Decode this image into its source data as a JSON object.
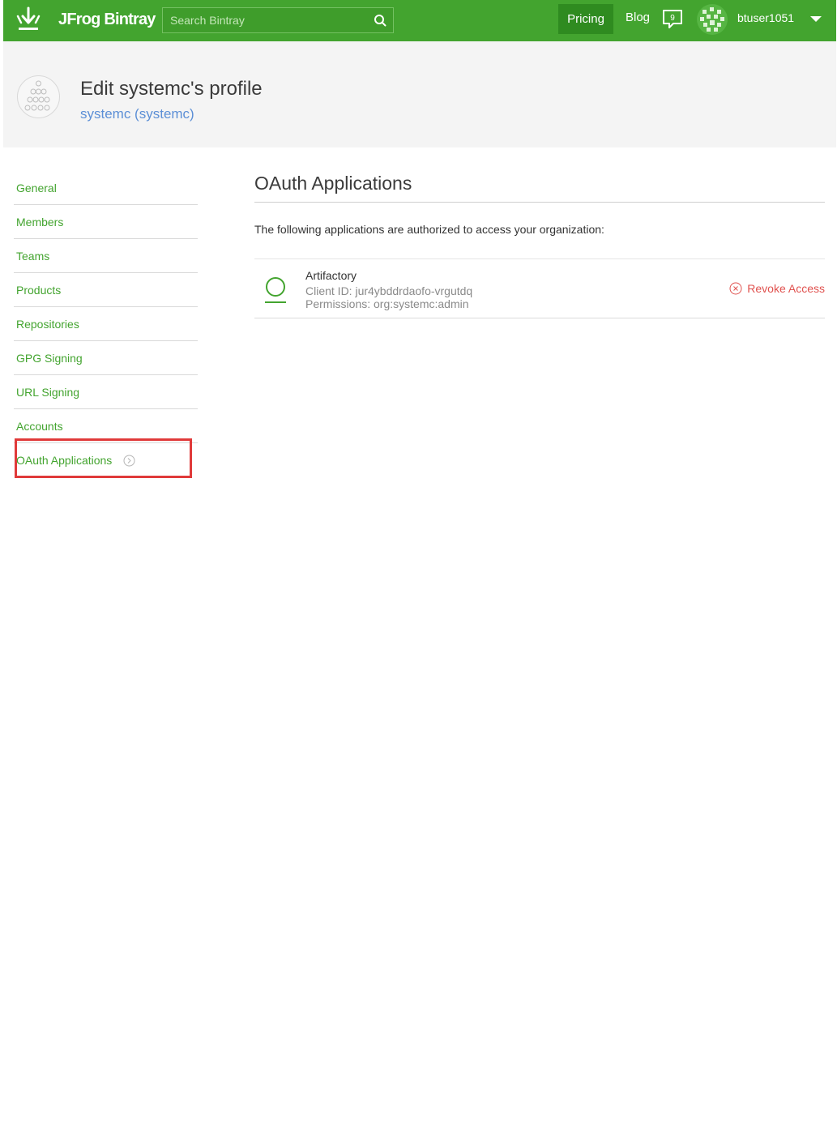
{
  "nav": {
    "brand": "JFrog Bintray",
    "search_placeholder": "Search Bintray",
    "pricing": "Pricing",
    "blog": "Blog",
    "chat_badge": "9",
    "username": "btuser1051"
  },
  "header": {
    "title": "Edit systemc's profile",
    "subtitle": "systemc (systemc)"
  },
  "sidebar": {
    "items": [
      {
        "label": "General"
      },
      {
        "label": "Members"
      },
      {
        "label": "Teams"
      },
      {
        "label": "Products"
      },
      {
        "label": "Repositories"
      },
      {
        "label": "GPG Signing"
      },
      {
        "label": "URL Signing"
      },
      {
        "label": "Accounts"
      },
      {
        "label": "OAuth Applications"
      }
    ],
    "active": "OAuth Applications"
  },
  "main": {
    "title": "OAuth Applications",
    "intro": "The following applications are authorized to access your organization:",
    "apps": [
      {
        "name": "Artifactory",
        "client_id": "Client ID: jur4ybddrdaofo-vrgutdq",
        "permissions": "Permissions: org:systemc:admin",
        "action": "Revoke Access"
      }
    ]
  },
  "colors": {
    "brand_green": "#43a42f",
    "pricing_bg": "#2f8b20",
    "revoke_red": "#e0524f",
    "highlight_red": "#e03a3a",
    "subtitle_blue": "#5c8fd6"
  }
}
